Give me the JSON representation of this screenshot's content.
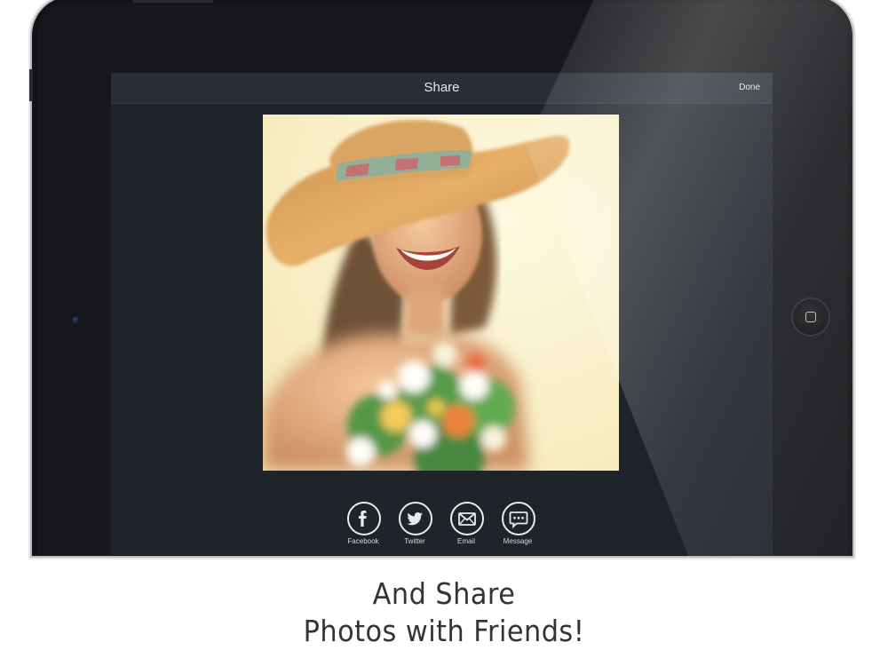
{
  "navbar": {
    "title": "Share",
    "done_label": "Done"
  },
  "photo": {
    "description_icon": "photo-woman-hat-flowers"
  },
  "share": {
    "items": [
      {
        "label": "Facebook",
        "icon": "facebook-icon"
      },
      {
        "label": "Twitter",
        "icon": "twitter-icon"
      },
      {
        "label": "Email",
        "icon": "email-icon"
      },
      {
        "label": "Message",
        "icon": "message-icon"
      }
    ]
  },
  "caption": {
    "line1": "And Share",
    "line2": "Photos with Friends!"
  },
  "colors": {
    "screen_bg": "#1f232a",
    "navbar_bg": "#2a2f37",
    "device_bezel": "#121315",
    "icon_stroke": "#e8eaed"
  }
}
